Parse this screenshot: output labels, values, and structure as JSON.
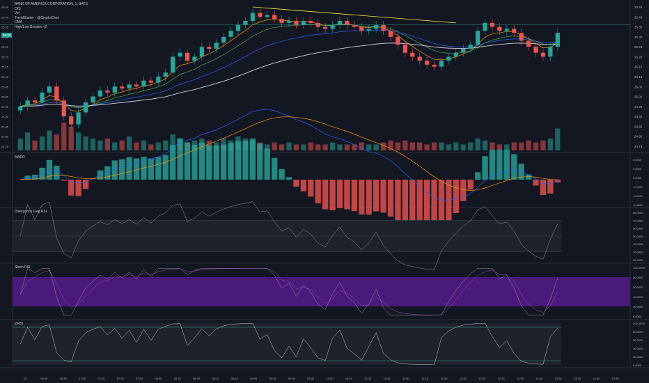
{
  "legend": {
    "symbol": "BANK OF AMERICA CORPORATION, 1, BATS",
    "indicators": [
      "O/S",
      "Vol",
      "TrendStarter - @CryptoChoe",
      "DMA",
      "High/Low Breaker v2"
    ]
  },
  "last_price_tag": "25.36",
  "panes": {
    "macd": "MACD",
    "rsi": "Divergence Flag RSI",
    "stoch": "Stoch RSI",
    "rsi2": "2 RSI"
  },
  "colors": {
    "bg": "#131722",
    "up": "#26a69a",
    "down": "#ef5350",
    "macd": "#2962ff",
    "signal": "#ff9800",
    "stoch_band": "#4a1a7a",
    "trend": "#ffeb3b"
  },
  "chart_data": {
    "type": "candlestick",
    "price_axis": [
      "25.45",
      "25.40",
      "25.35",
      "25.30",
      "25.25",
      "25.20",
      "25.15",
      "25.10",
      "25.05",
      "25.00",
      "24.95",
      "24.90",
      "24.85",
      "24.80",
      "24.75"
    ],
    "price_range": [
      24.75,
      25.45
    ],
    "macd_axis": [
      "0.0400",
      "0.0200",
      "0.0000",
      "-0.0200",
      "-0.0400",
      "-0.0600"
    ],
    "rsi_axis": [
      "80.0000",
      "70.0000",
      "60.0000",
      "50.0000",
      "40.0000",
      "30.0000",
      "20.0000"
    ],
    "stoch_axis": [
      "100.0000",
      "80.0000",
      "60.0000",
      "40.0000",
      "20.0000",
      "0.0000"
    ],
    "rsi2_axis": [
      "100.0000",
      "80.0000",
      "60.0000",
      "40.0000",
      "20.0000",
      "0.0000"
    ],
    "time_axis": [
      "18",
      "06:30",
      "06:45",
      "07:00",
      "07:15",
      "07:30",
      "07:45",
      "08:00",
      "08:15",
      "08:30",
      "08:41",
      "08:52",
      "09:05",
      "09:16",
      "09:30",
      "09:45",
      "10:00",
      "10:15",
      "10:30",
      "10:45",
      "11:00",
      "11:15",
      "11:30",
      "11:45",
      "12:00",
      "12:15",
      "12:30",
      "12:45",
      "13:00",
      "13:15",
      "13:30",
      "13:45"
    ],
    "close": [
      24.95,
      24.98,
      24.97,
      25.02,
      25.05,
      24.98,
      24.9,
      24.86,
      24.92,
      24.97,
      25.0,
      25.03,
      25.02,
      25.05,
      25.04,
      25.06,
      25.05,
      25.08,
      25.07,
      25.1,
      25.12,
      25.2,
      25.22,
      25.18,
      25.2,
      25.25,
      25.24,
      25.27,
      25.3,
      25.33,
      25.36,
      25.38,
      25.42,
      25.4,
      25.41,
      25.39,
      25.37,
      25.38,
      25.36,
      25.38,
      25.37,
      25.35,
      25.34,
      25.36,
      25.38,
      25.36,
      25.35,
      25.33,
      25.34,
      25.36,
      25.33,
      25.3,
      25.26,
      25.22,
      25.2,
      25.18,
      25.16,
      25.15,
      25.18,
      25.2,
      25.22,
      25.24,
      25.26,
      25.33,
      25.37,
      25.35,
      25.33,
      25.34,
      25.32,
      25.28,
      25.25,
      25.22,
      25.2,
      25.25,
      25.32
    ],
    "volume": [
      6,
      9,
      5,
      7,
      10,
      8,
      14,
      12,
      9,
      7,
      6,
      5,
      6,
      4,
      5,
      7,
      4,
      5,
      3,
      4,
      5,
      8,
      6,
      4,
      5,
      6,
      5,
      4,
      6,
      5,
      7,
      6,
      5,
      4,
      3,
      4,
      3,
      4,
      3,
      3,
      4,
      3,
      3,
      4,
      3,
      3,
      3,
      4,
      3,
      3,
      4,
      5,
      4,
      5,
      4,
      4,
      3,
      4,
      4,
      3,
      4,
      3,
      4,
      6,
      5,
      4,
      3,
      3,
      4,
      4,
      5,
      4,
      5,
      6,
      11
    ]
  }
}
